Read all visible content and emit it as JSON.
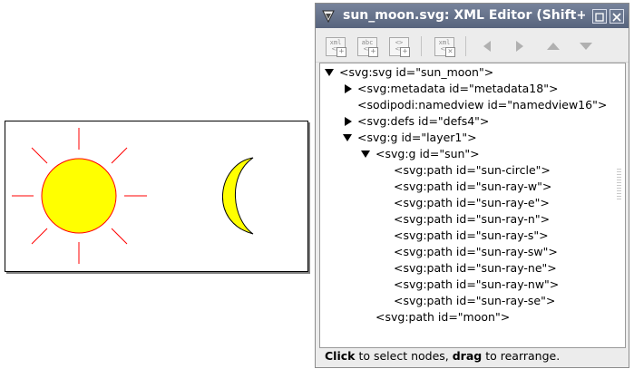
{
  "canvas": {
    "sun_fill": "#ffff00",
    "sun_stroke": "#ff0000",
    "moon_fill": "#ffff00",
    "moon_stroke": "#000000"
  },
  "xml_editor": {
    "title": "sun_moon.svg: XML Editor (Shift+Ctrl+X)",
    "toolbar": {
      "new_element_icon": "new-element-node-icon",
      "new_text_icon": "new-text-node-icon",
      "duplicate_icon": "duplicate-node-icon",
      "delete_icon": "delete-node-icon",
      "unindent_icon": "arrow-left-icon",
      "indent_icon": "arrow-right-icon",
      "raise_icon": "arrow-up-icon",
      "lower_icon": "arrow-down-icon"
    },
    "tree": [
      {
        "text": "<svg:svg id=\"sun_moon\">",
        "expander": "open"
      },
      {
        "text": "<svg:metadata id=\"metadata18\">",
        "expander": "closed"
      },
      {
        "text": "<sodipodi:namedview id=\"namedview16\">",
        "expander": "none"
      },
      {
        "text": "<svg:defs id=\"defs4\">",
        "expander": "closed"
      },
      {
        "text": "<svg:g id=\"layer1\">",
        "expander": "open"
      },
      {
        "text": "<svg:g id=\"sun\">",
        "expander": "open"
      },
      {
        "text": "<svg:path id=\"sun-circle\">",
        "expander": "none"
      },
      {
        "text": "<svg:path id=\"sun-ray-w\">",
        "expander": "none"
      },
      {
        "text": "<svg:path id=\"sun-ray-e\">",
        "expander": "none"
      },
      {
        "text": "<svg:path id=\"sun-ray-n\">",
        "expander": "none"
      },
      {
        "text": "<svg:path id=\"sun-ray-s\">",
        "expander": "none"
      },
      {
        "text": "<svg:path id=\"sun-ray-sw\">",
        "expander": "none"
      },
      {
        "text": "<svg:path id=\"sun-ray-ne\">",
        "expander": "none"
      },
      {
        "text": "<svg:path id=\"sun-ray-nw\">",
        "expander": "none"
      },
      {
        "text": "<svg:path id=\"sun-ray-se\">",
        "expander": "none"
      },
      {
        "text": "<svg:path id=\"moon\">",
        "expander": "none"
      }
    ],
    "status": {
      "click_word": "Click",
      "middle": " to select nodes, ",
      "drag_word": "drag",
      "end": " to rearrange."
    }
  }
}
